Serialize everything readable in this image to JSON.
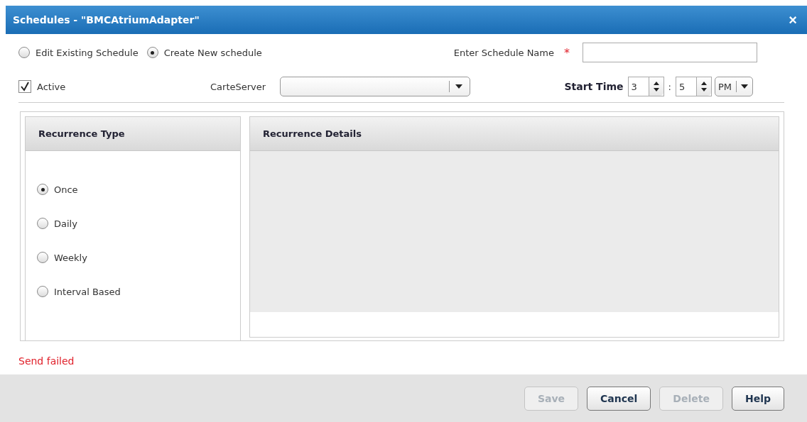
{
  "window": {
    "title": "Schedules - \"BMCAtriumAdapter\"",
    "close": "×"
  },
  "mode_options": [
    {
      "label": "Edit Existing Schedule",
      "selected": false
    },
    {
      "label": "Create New schedule",
      "selected": true
    }
  ],
  "schedule_name": {
    "label": "Enter Schedule Name",
    "required": true,
    "required_mark": "*"
  },
  "active": {
    "label": "Active",
    "checked": true
  },
  "server": {
    "label": "CarteServer"
  },
  "start_time": {
    "label": "Start Time",
    "hour": "3",
    "separator": ":",
    "minute": "5",
    "period": "PM"
  },
  "recurrence_type": {
    "title": "Recurrence Type",
    "options": [
      {
        "label": "Once",
        "selected": true
      },
      {
        "label": "Daily",
        "selected": false
      },
      {
        "label": "Weekly",
        "selected": false
      },
      {
        "label": "Interval Based",
        "selected": false
      }
    ]
  },
  "recurrence_details": {
    "title": "Recurrence Details"
  },
  "status_message": "Send failed",
  "buttons": [
    {
      "label": "Save",
      "disabled": true
    },
    {
      "label": "Cancel",
      "disabled": false
    },
    {
      "label": "Delete",
      "disabled": true
    },
    {
      "label": "Help",
      "disabled": false
    }
  ]
}
